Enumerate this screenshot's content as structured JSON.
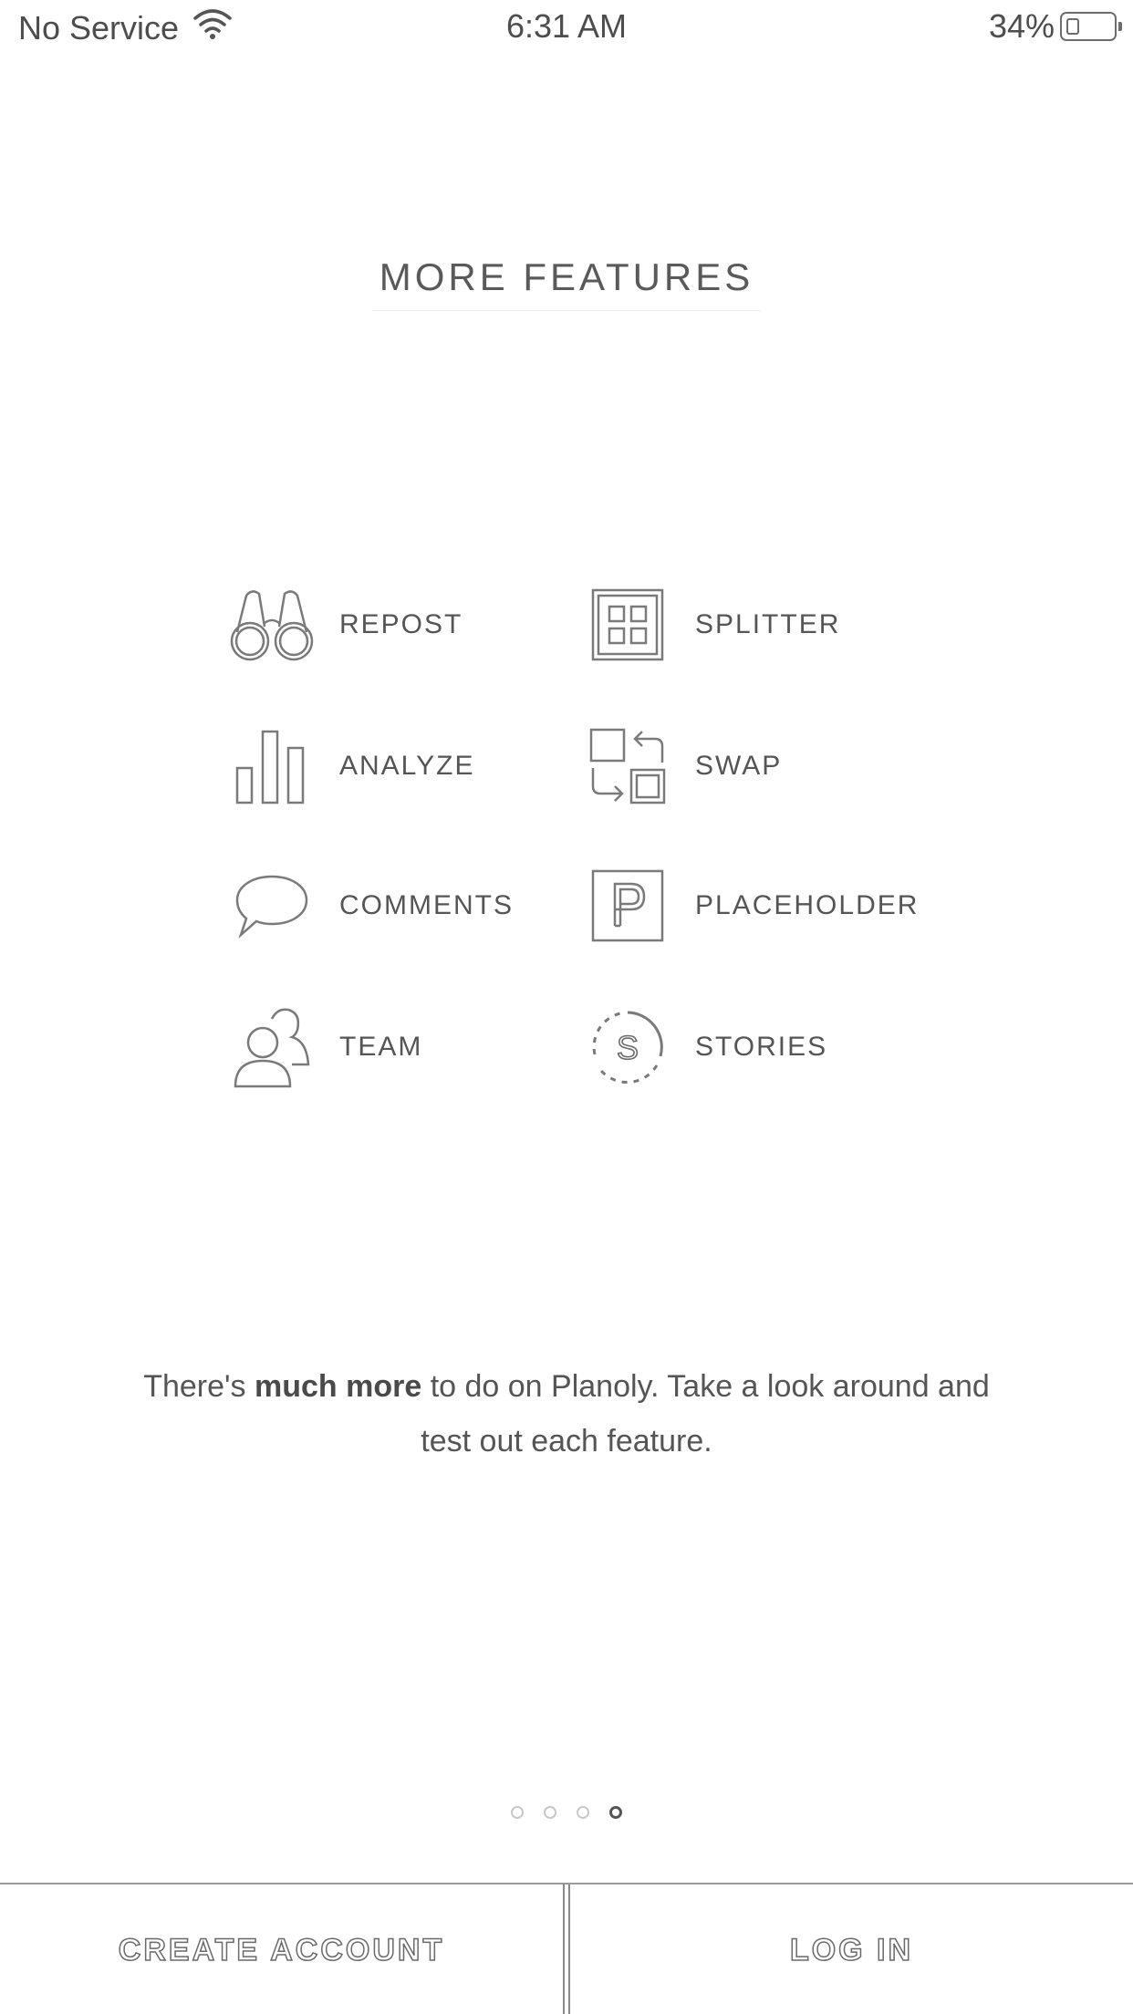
{
  "status_bar": {
    "carrier": "No Service",
    "time": "6:31 AM",
    "battery_percent": "34%",
    "battery_level": 0.34,
    "icons": [
      "wifi-icon",
      "battery-icon"
    ]
  },
  "page": {
    "title": "MORE FEATURES"
  },
  "features": [
    {
      "label": "REPOST",
      "icon": "binoculars-icon"
    },
    {
      "label": "SPLITTER",
      "icon": "grid-icon"
    },
    {
      "label": "ANALYZE",
      "icon": "bar-chart-icon"
    },
    {
      "label": "SWAP",
      "icon": "swap-icon"
    },
    {
      "label": "COMMENTS",
      "icon": "speech-bubble-icon"
    },
    {
      "label": "PLACEHOLDER",
      "icon": "placeholder-p-icon"
    },
    {
      "label": "TEAM",
      "icon": "team-icon"
    },
    {
      "label": "STORIES",
      "icon": "stories-icon"
    }
  ],
  "description": {
    "prefix": "There's ",
    "emphasis": "much more",
    "suffix": " to do on Planoly. Take a look around and test out each feature."
  },
  "pagination": {
    "total": 4,
    "current": 4
  },
  "buttons": {
    "create_account": "CREATE ACCOUNT",
    "log_in": "LOG IN"
  }
}
